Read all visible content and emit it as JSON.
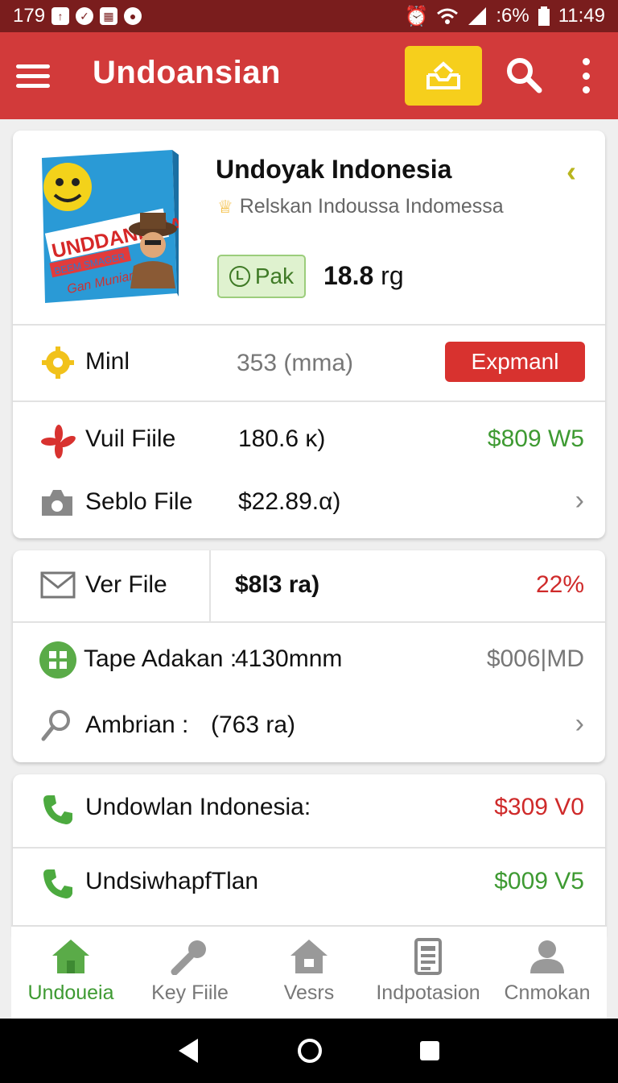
{
  "status_bar": {
    "left_text": "179",
    "battery": ":6%",
    "time": "11:49"
  },
  "app_bar": {
    "title": "Undoansian"
  },
  "product": {
    "title": "Undoyak Indonesia",
    "subtitle": "Relskan Indoussa Indomessa",
    "badge_label": "Pak",
    "badge_icon": "L",
    "weight_value": "18.8",
    "weight_unit": "rg",
    "box_art": {
      "line1": "UNDDANESIA",
      "line2": "BEEM SMAGER",
      "line3": "Gan Munian!"
    }
  },
  "rows_card1": [
    {
      "label": "Minl",
      "value": "353 (mma)",
      "button": "Expmanl",
      "icon": "gear-icon"
    },
    {
      "label": "Vuil Fiile",
      "value": "180.6 κ)",
      "right": "$809 W5",
      "icon": "asterisk-icon"
    },
    {
      "label": "Seblo File",
      "value": "$22.89.α)",
      "icon": "camera-icon"
    }
  ],
  "rows_card2": [
    {
      "label": "Ver File",
      "value": "$8l3 ra)",
      "right": "22%",
      "icon": "mail-icon"
    },
    {
      "label": "Tape Adakan :",
      "value": "4130mnm",
      "right": "$006|MD",
      "icon": "grid-icon"
    },
    {
      "label": "Ambrian  :",
      "value": "(763 ra)",
      "icon": "search-icon"
    }
  ],
  "rows_card3": [
    {
      "label": "Undowlan Indonesia:",
      "right": "$309 V0",
      "icon": "phone-icon"
    },
    {
      "label": "UndsiwhapfTlan",
      "right": "$009 V5",
      "icon": "phone-icon"
    }
  ],
  "bottom_nav": [
    {
      "label": "Undoueia",
      "icon": "home-icon",
      "active": true
    },
    {
      "label": "Key Fiile",
      "icon": "wrench-icon",
      "active": false
    },
    {
      "label": "Vesrs",
      "icon": "house-icon",
      "active": false
    },
    {
      "label": "Indpotasion",
      "icon": "document-icon",
      "active": false
    },
    {
      "label": "Cnmokan",
      "icon": "person-icon",
      "active": false
    }
  ],
  "colors": {
    "appbar": "#d23a3a",
    "statusbar": "#7a1d1d",
    "accent_yellow": "#f6cf1c",
    "green": "#3e9a32",
    "red": "#cf2a2a"
  }
}
